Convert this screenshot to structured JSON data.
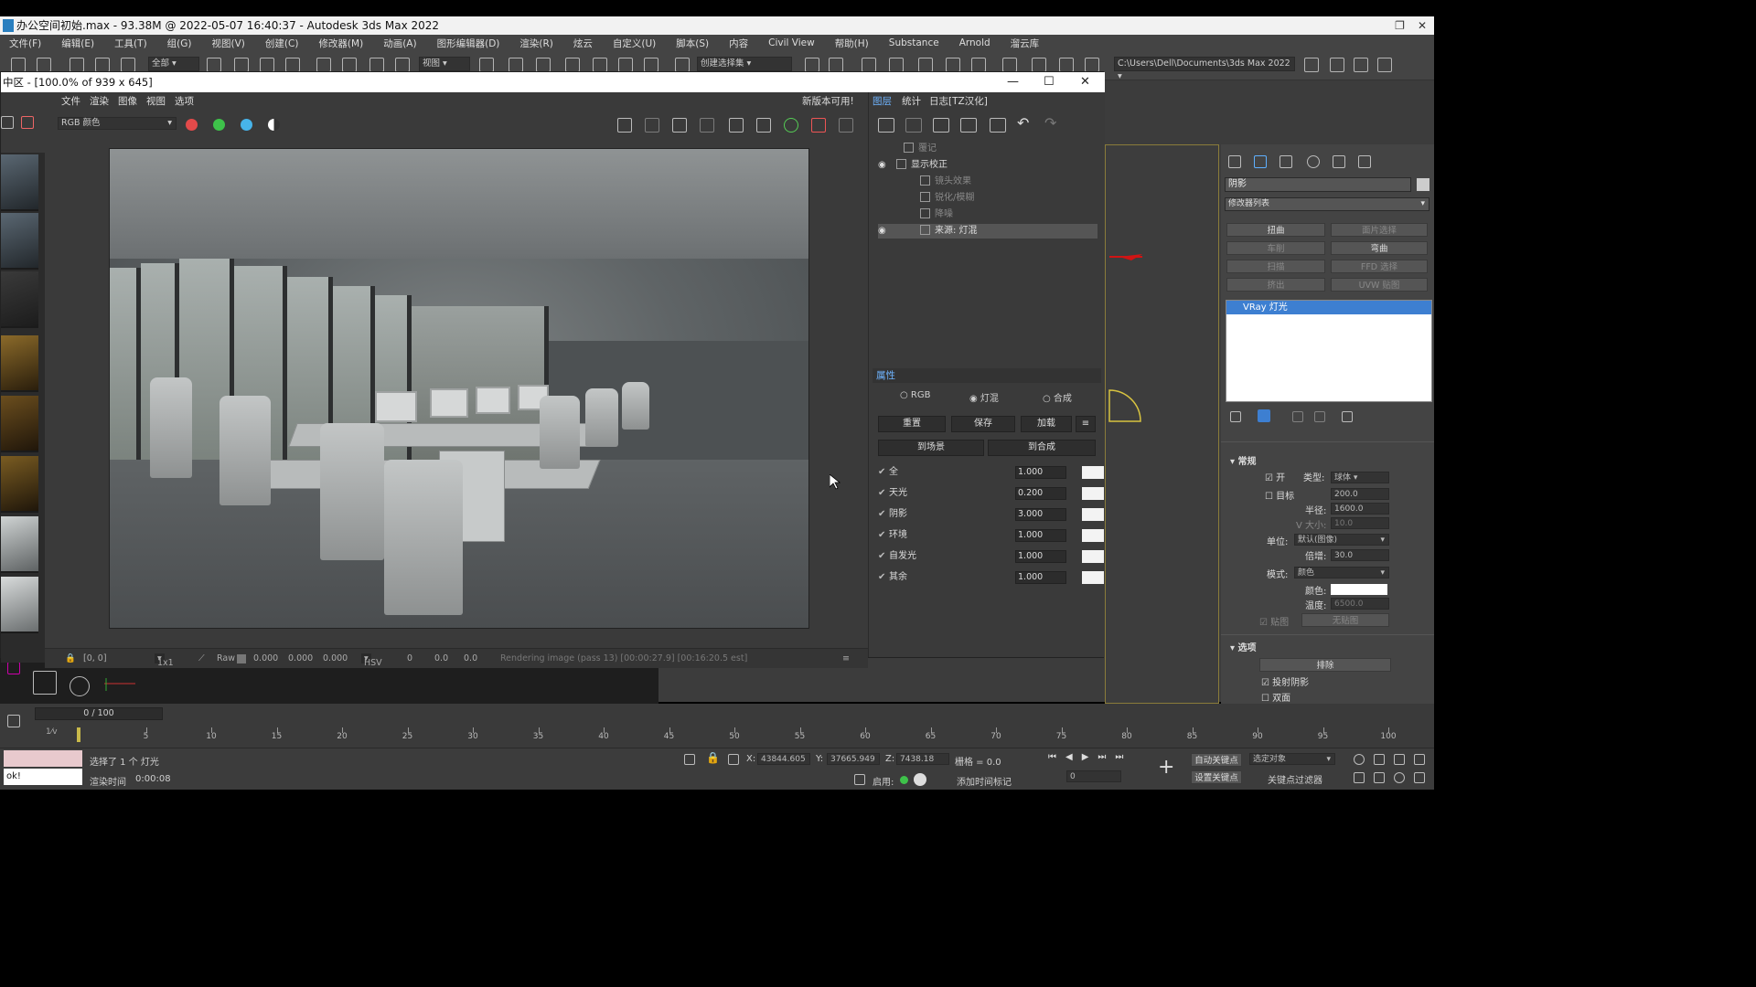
{
  "app": {
    "title": "办公空间初始.max - 93.38M @ 2022-05-07 16:40:37 - Autodesk 3ds Max 2022"
  },
  "menu": [
    "文件(F)",
    "编辑(E)",
    "工具(T)",
    "组(G)",
    "视图(V)",
    "创建(C)",
    "修改器(M)",
    "动画(A)",
    "图形编辑器(D)",
    "渲染(R)",
    "炫云",
    "自定义(U)",
    "脚本(S)",
    "内容",
    "Civil View",
    "帮助(H)",
    "Substance",
    "Arnold",
    "溜云库"
  ],
  "toolbar": {
    "filter_select": "全部",
    "view_select": "视图",
    "selection_set": "创建选择集",
    "workspace_path": "C:\\Users\\Dell\\Documents\\3ds Max 2022"
  },
  "vfb": {
    "title": "中区 - [100.0% of 939 x 645]",
    "menu": [
      "文件",
      "渲染",
      "图像",
      "视图",
      "选项"
    ],
    "update_notice": "新版本可用!",
    "channel_select": "RGB 颜色",
    "status": {
      "coords": "[0, 0]",
      "zoom": "1x1",
      "mode": "Raw",
      "rgb": [
        "0.000",
        "0.000",
        "0.000"
      ],
      "color_space": "HSV",
      "hsv": [
        "0",
        "0.0",
        "0.0"
      ],
      "progress_text": "Rendering image (pass 13) [00:00:27.9] [00:16:20.5 est]"
    }
  },
  "layers_panel": {
    "tabs": [
      "图层",
      "统计",
      "日志[TZ汉化]"
    ],
    "layers": [
      {
        "label": "覆记",
        "visible": false
      },
      {
        "label": "显示校正",
        "visible": true
      },
      {
        "label": "镜头效果",
        "visible": false
      },
      {
        "label": "锐化/模糊",
        "visible": false
      },
      {
        "label": "降噪",
        "visible": false
      },
      {
        "label": "来源: 灯混",
        "visible": true,
        "selected": true
      }
    ],
    "properties_title": "属性",
    "radio": {
      "options": [
        "RGB",
        "灯混",
        "合成"
      ],
      "selected": "灯混"
    },
    "buttons": {
      "reset": "重置",
      "save": "保存",
      "load": "加载",
      "to_scene": "到场景",
      "to_composite": "到合成"
    },
    "rows": [
      {
        "label": "全",
        "value": "1.000"
      },
      {
        "label": "天光",
        "value": "0.200"
      },
      {
        "label": "阴影",
        "value": "3.000"
      },
      {
        "label": "环境",
        "value": "1.000"
      },
      {
        "label": "自发光",
        "value": "1.000"
      },
      {
        "label": "其余",
        "value": "1.000"
      }
    ]
  },
  "command_panel": {
    "object_name": "阴影",
    "modifier_list": "修改器列表",
    "mod_buttons": [
      "扭曲",
      "面片选择",
      "车削",
      "弯曲",
      "扫描",
      "FFD 选择",
      "挤出",
      "UVW 贴图"
    ],
    "stack_item": "VRay 灯光",
    "general": {
      "title": "常规",
      "on_label": "开",
      "type_label": "类型:",
      "type_value": "球体",
      "target_label": "目标",
      "target_value": "200.0",
      "radius_label": "半径:",
      "radius_value": "1600.0",
      "vsize_label": "V 大小:",
      "vsize_value": "10.0",
      "units_label": "单位:",
      "units_value": "默认(图像)",
      "multiplier_label": "倍增:",
      "multiplier_value": "30.0",
      "mode_label": "模式:",
      "mode_value": "颜色",
      "color_label": "颜色:",
      "temp_label": "温度:",
      "temp_value": "6500.0",
      "texture_label": "贴图",
      "no_map": "无贴图"
    },
    "options": {
      "title": "选项",
      "exclude": "排除",
      "cast_shadows": "投射阴影",
      "double_sided": "双面"
    }
  },
  "timeline": {
    "frame_counter": "0 / 100",
    "ticks": [
      "5",
      "10",
      "15",
      "20",
      "25",
      "30",
      "35",
      "40",
      "45",
      "50",
      "55",
      "60",
      "65",
      "70",
      "75",
      "80",
      "85",
      "90",
      "95",
      "100"
    ]
  },
  "status": {
    "selection": "选择了 1 个 灯光",
    "render_time_label": "渲染时间",
    "render_time": "0:00:08",
    "maxscript": "ok!",
    "x": "43844.605",
    "y": "37665.949",
    "z": "7438.18",
    "grid": "栅格 = 0.0",
    "enable": "启用:",
    "add_time_tag": "添加时间标记",
    "auto_key": "自动关键点",
    "set_key": "设置关键点",
    "selected_object": "选定对象",
    "key_filters": "关键点过滤器",
    "frame": "0"
  }
}
